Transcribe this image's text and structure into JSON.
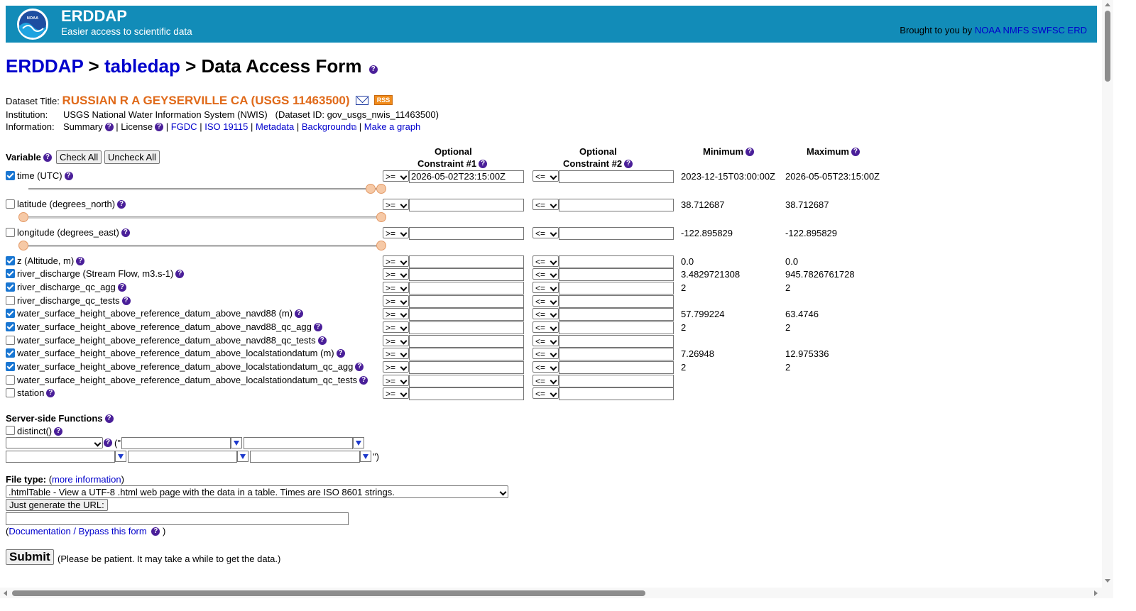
{
  "banner": {
    "brand": "ERDDAP",
    "tagline": "Easier access to scientific data",
    "credit_prefix": "Brought to you by",
    "credit_links": "NOAA NMFS SWFSC ERD",
    "logo_text": "NOAA"
  },
  "heading": {
    "crumb1": "ERDDAP",
    "sep": " > ",
    "crumb2": "tabledap",
    "current": "Data Access Form"
  },
  "dataset": {
    "title_label": "Dataset Title:",
    "title": "RUSSIAN R A GEYSERVILLE CA (USGS 11463500)",
    "rss": "RSS",
    "institution_label": "Institution:",
    "institution": "USGS National Water Information System (NWIS)",
    "dataset_id": "(Dataset ID: gov_usgs_nwis_11463500)",
    "information_label": "Information:",
    "summary": "Summary",
    "license": "License",
    "fgdc": "FGDC",
    "iso": "ISO 19115",
    "metadata": "Metadata",
    "background": "Background",
    "make_graph": "Make a graph",
    "sep": "|"
  },
  "table_header": {
    "variable": "Variable",
    "check_all": "Check All",
    "uncheck_all": "Uncheck All",
    "c1_line1": "Optional",
    "c1_line2": "Constraint #1",
    "c2_line1": "Optional",
    "c2_line2": "Constraint #2",
    "minimum": "Minimum",
    "maximum": "Maximum"
  },
  "variables": [
    {
      "label": "time (UTC)",
      "checked": true,
      "op1": ">=",
      "val1": "2026-05-02T23:15:00Z",
      "op2": "<=",
      "val2": "",
      "min": "2023-12-15T03:00:00Z",
      "max": "2026-05-05T23:15:00Z"
    },
    {
      "label": "latitude (degrees_north)",
      "checked": false,
      "op1": ">=",
      "val1": "",
      "op2": "<=",
      "val2": "",
      "min": "38.712687",
      "max": "38.712687"
    },
    {
      "label": "longitude (degrees_east)",
      "checked": false,
      "op1": ">=",
      "val1": "",
      "op2": "<=",
      "val2": "",
      "min": "-122.895829",
      "max": "-122.895829"
    },
    {
      "label": "z (Altitude, m)",
      "checked": true,
      "op1": ">=",
      "val1": "",
      "op2": "<=",
      "val2": "",
      "min": "0.0",
      "max": "0.0"
    },
    {
      "label": "river_discharge (Stream Flow, m3.s-1)",
      "checked": true,
      "op1": ">=",
      "val1": "",
      "op2": "<=",
      "val2": "",
      "min": "3.4829721308",
      "max": "945.7826761728"
    },
    {
      "label": "river_discharge_qc_agg",
      "checked": true,
      "op1": ">=",
      "val1": "",
      "op2": "<=",
      "val2": "",
      "min": "2",
      "max": "2"
    },
    {
      "label": "river_discharge_qc_tests",
      "checked": false,
      "op1": ">=",
      "val1": "",
      "op2": "<=",
      "val2": "",
      "min": "",
      "max": ""
    },
    {
      "label": "water_surface_height_above_reference_datum_above_navd88 (m)",
      "checked": true,
      "op1": ">=",
      "val1": "",
      "op2": "<=",
      "val2": "",
      "min": "57.799224",
      "max": "63.4746"
    },
    {
      "label": "water_surface_height_above_reference_datum_above_navd88_qc_agg",
      "checked": true,
      "op1": ">=",
      "val1": "",
      "op2": "<=",
      "val2": "",
      "min": "2",
      "max": "2"
    },
    {
      "label": "water_surface_height_above_reference_datum_above_navd88_qc_tests",
      "checked": false,
      "op1": ">=",
      "val1": "",
      "op2": "<=",
      "val2": "",
      "min": "",
      "max": ""
    },
    {
      "label": "water_surface_height_above_reference_datum_above_localstationdatum (m)",
      "checked": true,
      "op1": ">=",
      "val1": "",
      "op2": "<=",
      "val2": "",
      "min": "7.26948",
      "max": "12.975336"
    },
    {
      "label": "water_surface_height_above_reference_datum_above_localstationdatum_qc_agg",
      "checked": true,
      "op1": ">=",
      "val1": "",
      "op2": "<=",
      "val2": "",
      "min": "2",
      "max": "2"
    },
    {
      "label": "water_surface_height_above_reference_datum_above_localstationdatum_qc_tests",
      "checked": false,
      "op1": ">=",
      "val1": "",
      "op2": "<=",
      "val2": "",
      "min": "",
      "max": ""
    },
    {
      "label": "station",
      "checked": false,
      "op1": ">=",
      "val1": "",
      "op2": "<=",
      "val2": "",
      "min": "",
      "max": ""
    }
  ],
  "server_functions": {
    "heading": "Server-side Functions",
    "distinct": "distinct()",
    "open_paren": "(\"",
    "close_paren": "\")"
  },
  "file_type": {
    "label": "File type:",
    "more_info_prefix": "(",
    "more_info": "more information",
    "more_info_suffix": ")",
    "selected": ".htmlTable - View a UTF-8 .html web page with the data in a table. Times are ISO 8601 strings.",
    "generate_url": "Just generate the URL:",
    "url_value": "",
    "doc_prefix": "(",
    "doc_link": "Documentation / Bypass this form",
    "doc_suffix": ")"
  },
  "submit": {
    "label": "Submit",
    "note": "(Please be patient. It may take a while to get the data.)"
  }
}
